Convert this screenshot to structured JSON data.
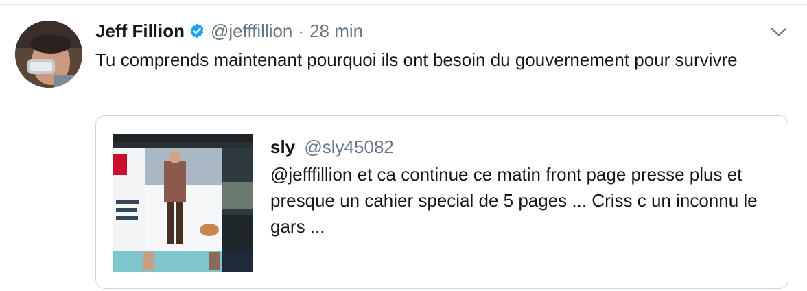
{
  "tweet": {
    "author_name": "Jeff Fillion",
    "author_handle": "@jefffillion",
    "separator": "·",
    "timestamp": "28 min",
    "text": "Tu comprends maintenant pourquoi ils ont besoin du gouvernement pour survivre",
    "verified": true
  },
  "quoted": {
    "author_name": "sly",
    "author_handle": "@sly45082",
    "text": "@jefffillion et ca continue ce matin front page presse plus et presque un cahier special de 5 pages ... Criss c un inconnu le gars ..."
  },
  "colors": {
    "text": "#14171a",
    "secondary": "#657786",
    "border": "#ccd6dd",
    "verified_blue": "#1da1f2"
  },
  "icons": {
    "verified": "verified-badge-icon",
    "caret": "chevron-down-icon"
  }
}
